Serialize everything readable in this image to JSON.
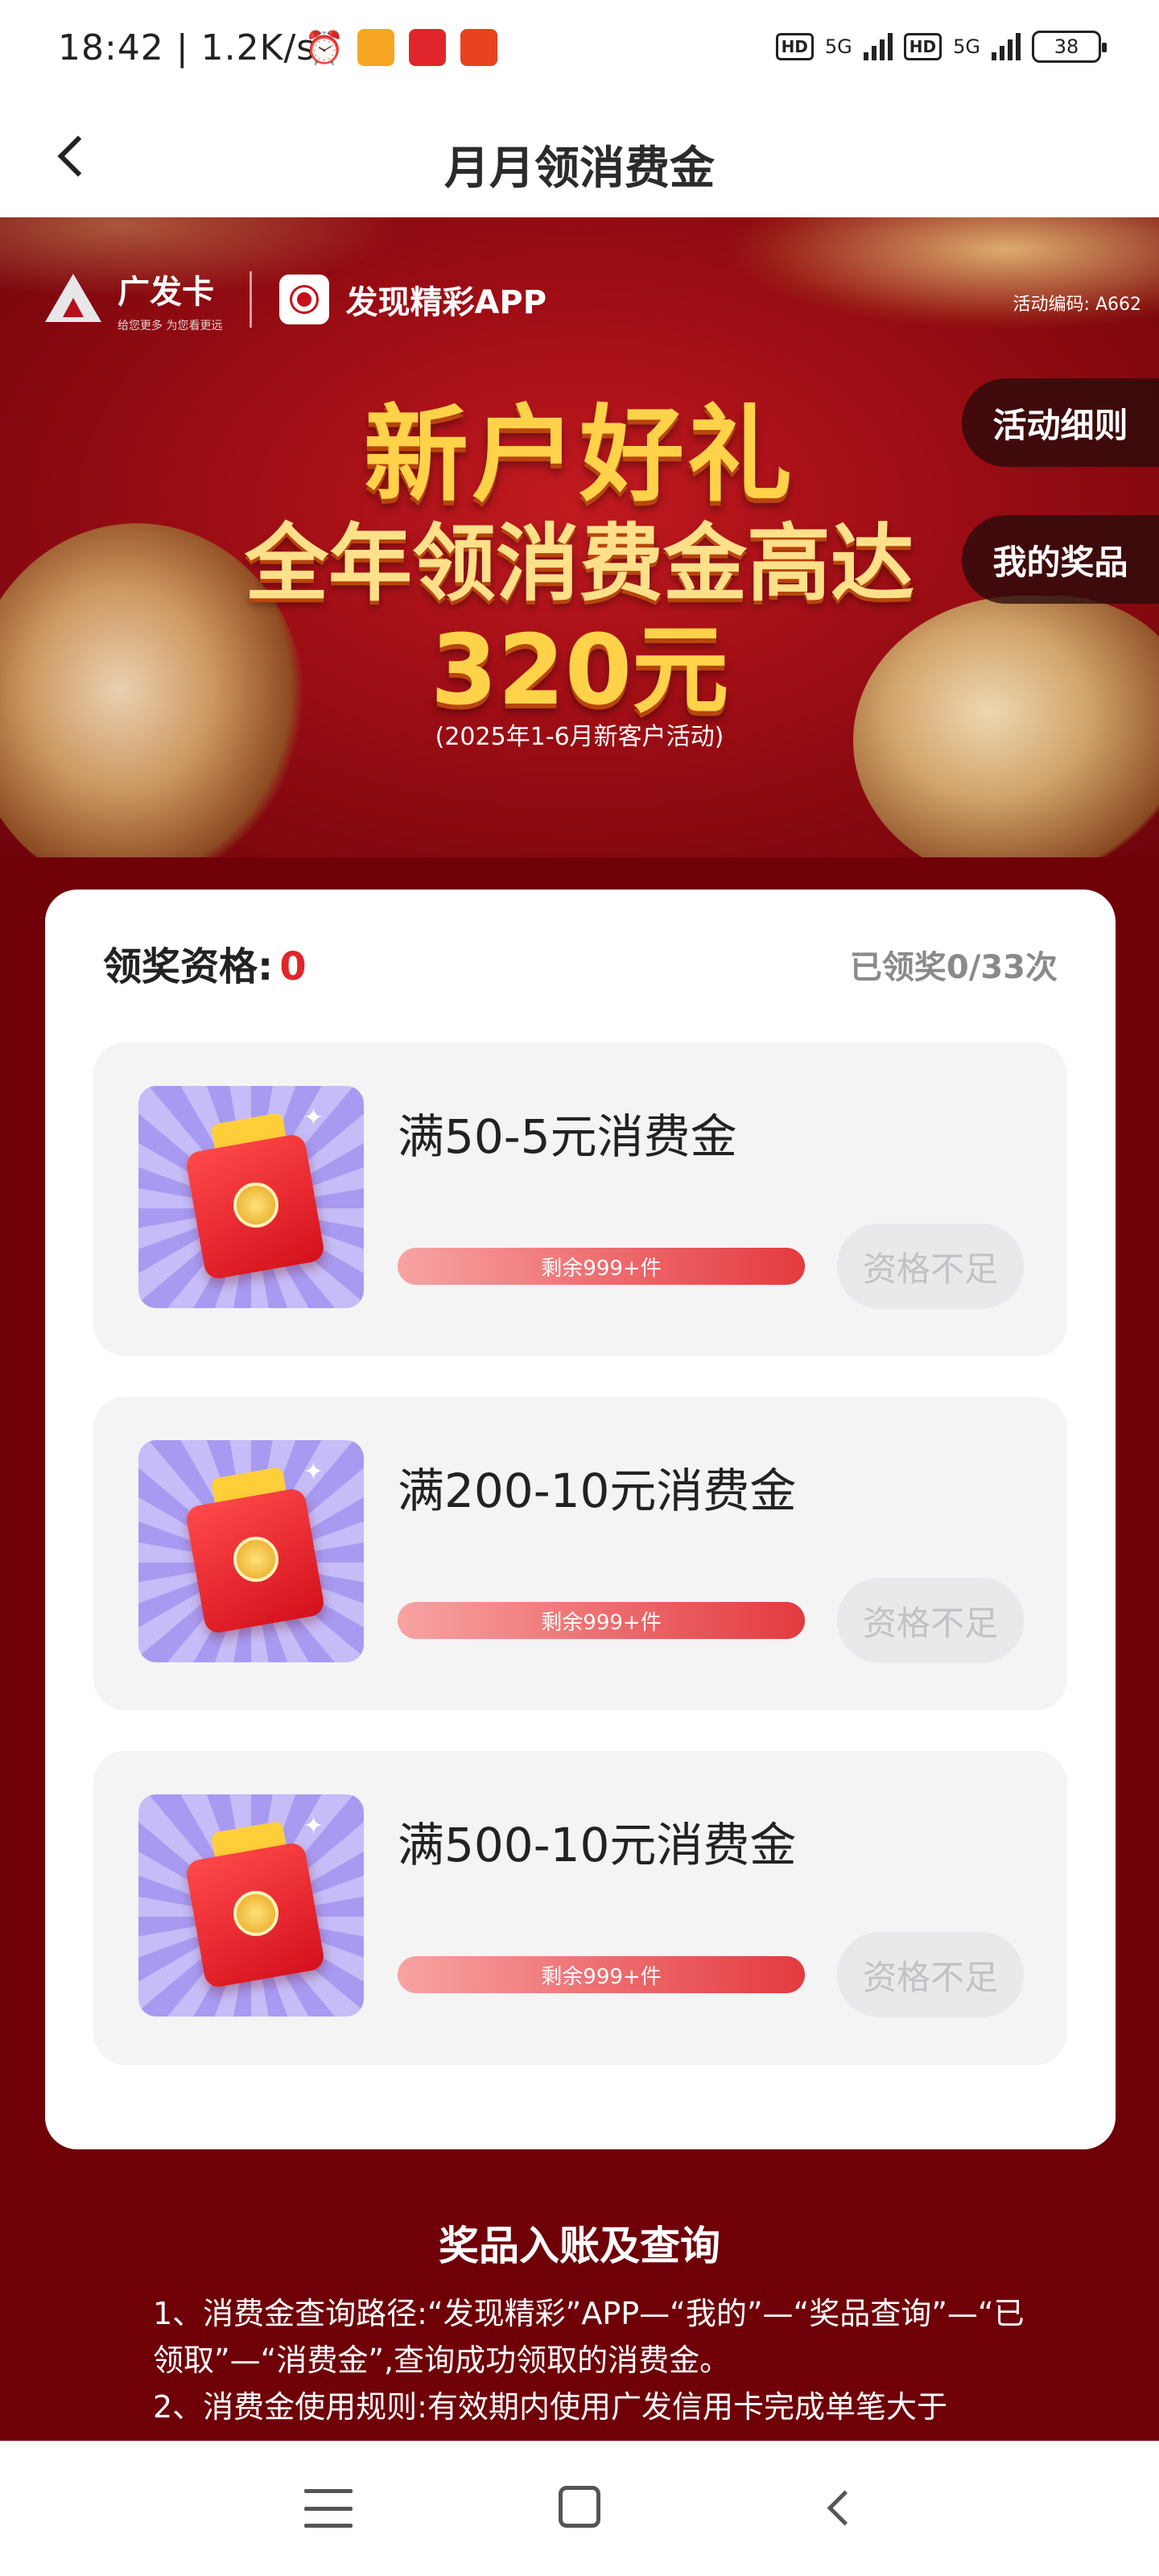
{
  "status_bar": {
    "time": "18:42",
    "net_speed": "1.2K/s",
    "network_1": "5G",
    "network_2": "5G",
    "hd_label": "HD",
    "battery": "38"
  },
  "header": {
    "title": "月月领消费金"
  },
  "banner": {
    "brand_name": "广发卡",
    "brand_tagline": "给您更多 为您看更远",
    "app_name": "发现精彩APP",
    "activity_code": "活动编码: A662",
    "headline_1": "新户好礼",
    "headline_2": "全年领消费金高达",
    "headline_3": "320元",
    "note": "(2025年1-6月新客户活动)",
    "rules_button": "活动细则",
    "prizes_button": "我的奖品"
  },
  "card": {
    "eligibility_label": "领奖资格:",
    "eligibility_count": "0",
    "claimed_text": "已领奖0/33次",
    "items": [
      {
        "title": "满50-5元消费金",
        "remaining": "剩余999+件",
        "button": "资格不足",
        "remaining_fill_pct": 100
      },
      {
        "title": "满200-10元消费金",
        "remaining": "剩余999+件",
        "button": "资格不足",
        "remaining_fill_pct": 100
      },
      {
        "title": "满500-10元消费金",
        "remaining": "剩余999+件",
        "button": "资格不足",
        "remaining_fill_pct": 100
      }
    ]
  },
  "info": {
    "title": "奖品入账及查询",
    "line_1": "1、消费金查询路径:“发现精彩”APP—“我的”—“奖品查询”—“已领取”—“消费金”,查询成功领取的消费金。",
    "line_2": "2、消费金使用规则:有效期内使用广发信用卡完成单笔大于"
  },
  "colors": {
    "accent_red": "#e0262c",
    "background": "#6f0008",
    "disabled_button": "#e9e9ec"
  },
  "icons": {
    "back": "chevron-left-icon",
    "nav_menu": "menu-icon",
    "nav_home": "home-icon",
    "nav_back": "back-icon"
  }
}
